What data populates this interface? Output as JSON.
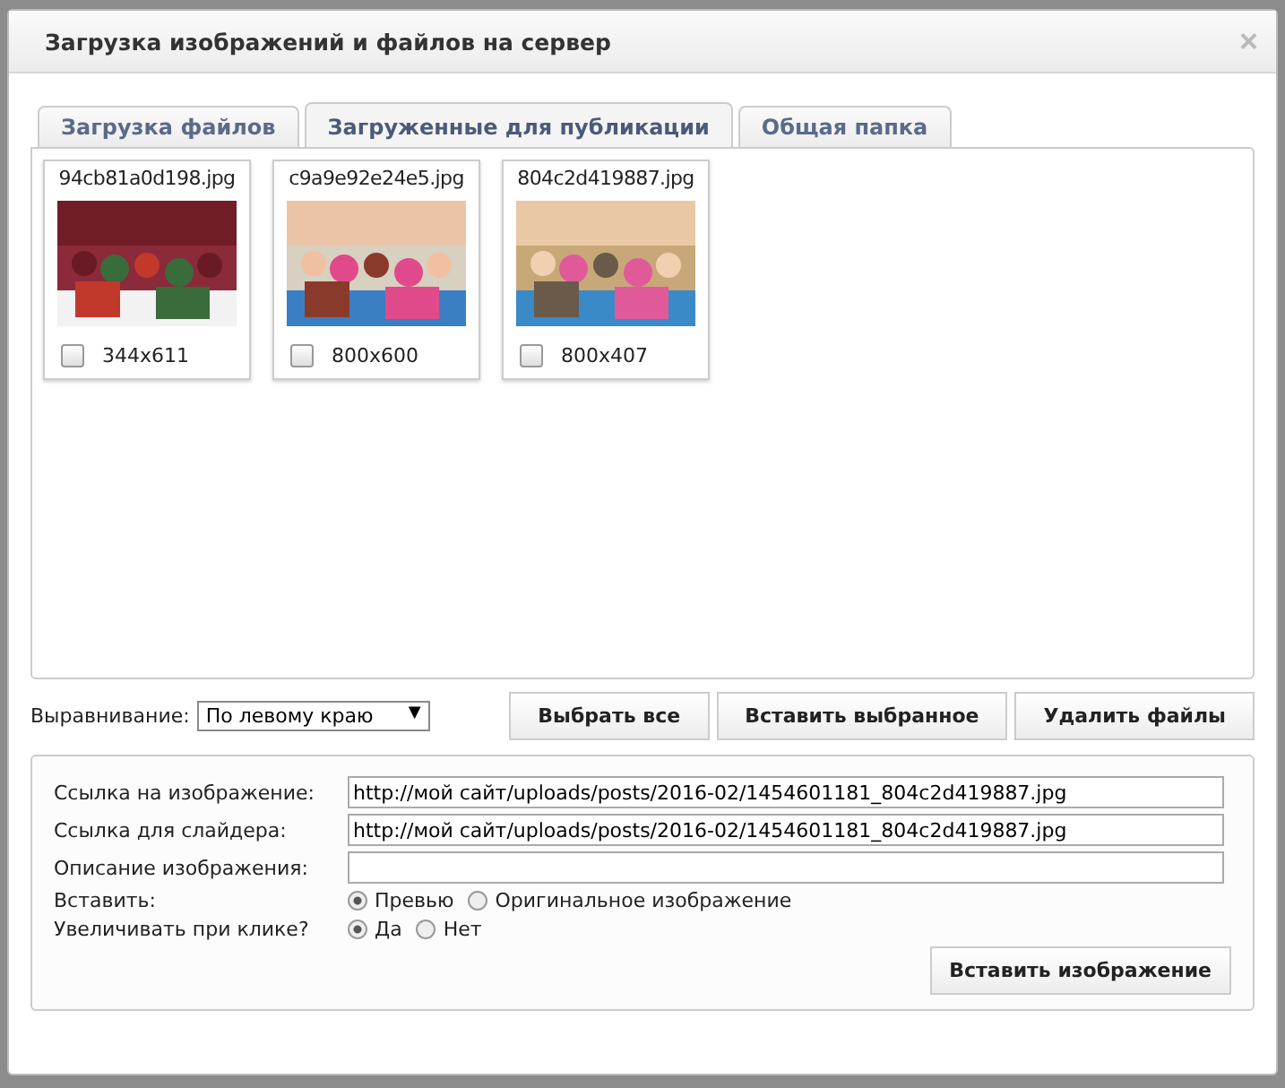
{
  "dialog": {
    "title": "Загрузка изображений и файлов на сервер",
    "close": "×"
  },
  "tabs": [
    {
      "label": "Загрузка файлов",
      "selected": false
    },
    {
      "label": "Загруженные для публикации",
      "selected": true
    },
    {
      "label": "Общая папка",
      "selected": false
    }
  ],
  "files": [
    {
      "name": "94cb81a0d198.jpg",
      "size": "344x611",
      "checked": false,
      "kind": "picture"
    },
    {
      "name": "c9a9e92e24e5.jpg",
      "size": "800x600",
      "checked": false,
      "kind": "picture"
    },
    {
      "name": "804c2d419887.jpg",
      "size": "800x407",
      "checked": false,
      "kind": "picture"
    }
  ],
  "alignment": {
    "label": "Выравнивание:",
    "value": "По левому краю",
    "arrow": "▼"
  },
  "buttons": [
    "Выбрать все",
    "Вставить выбранное",
    "Удалить файлы"
  ],
  "form": {
    "fields": [
      {
        "label": "Ссылка на изображение:",
        "value": "http://мой сайт/uploads/posts/2016-02/1454601181_804c2d419887.jpg"
      },
      {
        "label": "Ссылка для слайдера:",
        "value": "http://мой сайт/uploads/posts/2016-02/1454601181_804c2d419887.jpg"
      },
      {
        "label": "Описание изображения:"
      }
    ],
    "radio_groups": [
      {
        "label": "Вставить:",
        "options": [
          {
            "label": "Превью",
            "selected": true
          },
          {
            "label": "Оригинальное изображение",
            "selected": false
          }
        ]
      },
      {
        "label": "Увеличивать при клике?",
        "options": [
          {
            "label": "Да",
            "selected": true
          },
          {
            "label": "Нет",
            "selected": false
          }
        ]
      }
    ],
    "submit": "Вставить изображение"
  }
}
